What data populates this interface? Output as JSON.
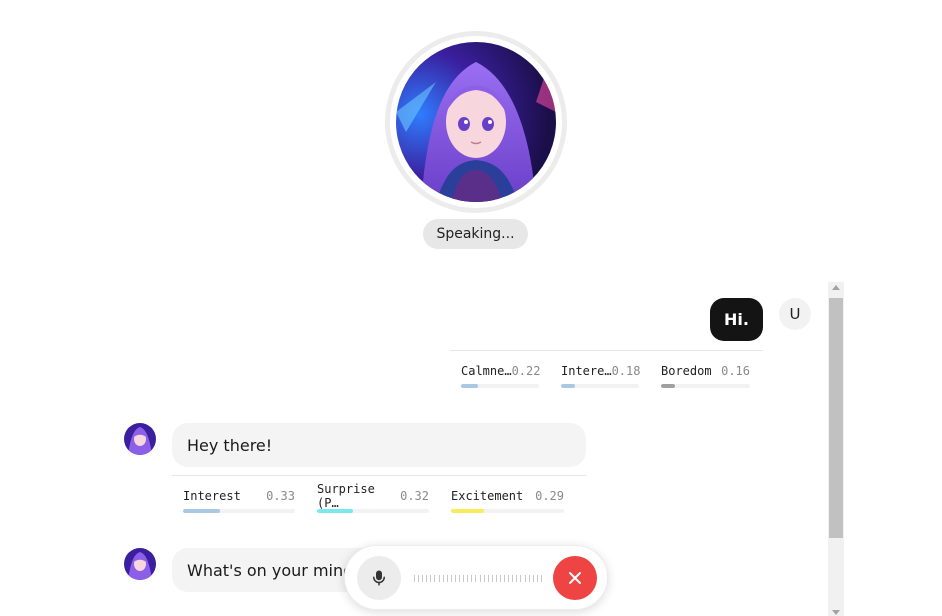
{
  "assistant": {
    "avatar_icon": "anime-girl-purple-hair-avatar",
    "status": "Speaking..."
  },
  "messages": [
    {
      "role": "user",
      "avatar_initial": "U",
      "text": "Hi.",
      "emotions": [
        {
          "label": "Calmne…",
          "value": "0.22",
          "fraction": 0.22,
          "color": "#a8c8e4"
        },
        {
          "label": "Intere…",
          "value": "0.18",
          "fraction": 0.18,
          "color": "#a8c8e4"
        },
        {
          "label": "Boredom",
          "value": "0.16",
          "fraction": 0.16,
          "color": "#a0a0a0"
        }
      ]
    },
    {
      "role": "assistant",
      "text": "Hey there!",
      "emotions": [
        {
          "label": "Interest",
          "value": "0.33",
          "fraction": 0.33,
          "color": "#a8c8e4"
        },
        {
          "label": "Surprise (P…",
          "value": "0.32",
          "fraction": 0.32,
          "color": "#7be8f0"
        },
        {
          "label": "Excitement",
          "value": "0.29",
          "fraction": 0.29,
          "color": "#f8ec5a"
        }
      ]
    },
    {
      "role": "assistant",
      "text": "What's on your mind"
    }
  ],
  "controls": {
    "mic_icon": "microphone-icon",
    "end_icon": "close-icon",
    "end_color": "#ef4444"
  }
}
